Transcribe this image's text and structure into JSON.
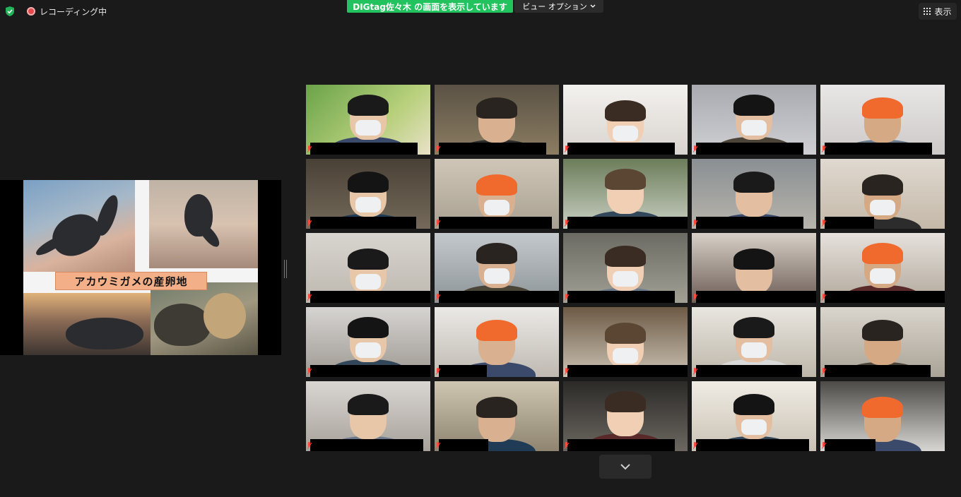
{
  "top_bar": {
    "recording_label": "レコーディング中",
    "sharing_banner": "DIGtag佐々木 の画面を表示しています",
    "view_options_label": "ビュー オプション",
    "view_button_label": "表示"
  },
  "shared_screen": {
    "caption": "アカウミガメの産卵地"
  },
  "icons": [
    "shield-check-icon",
    "recording-icon",
    "chevron-down-icon",
    "grid-view-icon",
    "muted-mic-icon",
    "scroll-down-icon"
  ],
  "colors": {
    "background": "#1a1a1a",
    "sharing_banner": "#22c35e",
    "active_speaker_border": "#d6ef8a",
    "muted_mic": "#ff4b3e",
    "caption_bg": "#f3b088"
  }
}
